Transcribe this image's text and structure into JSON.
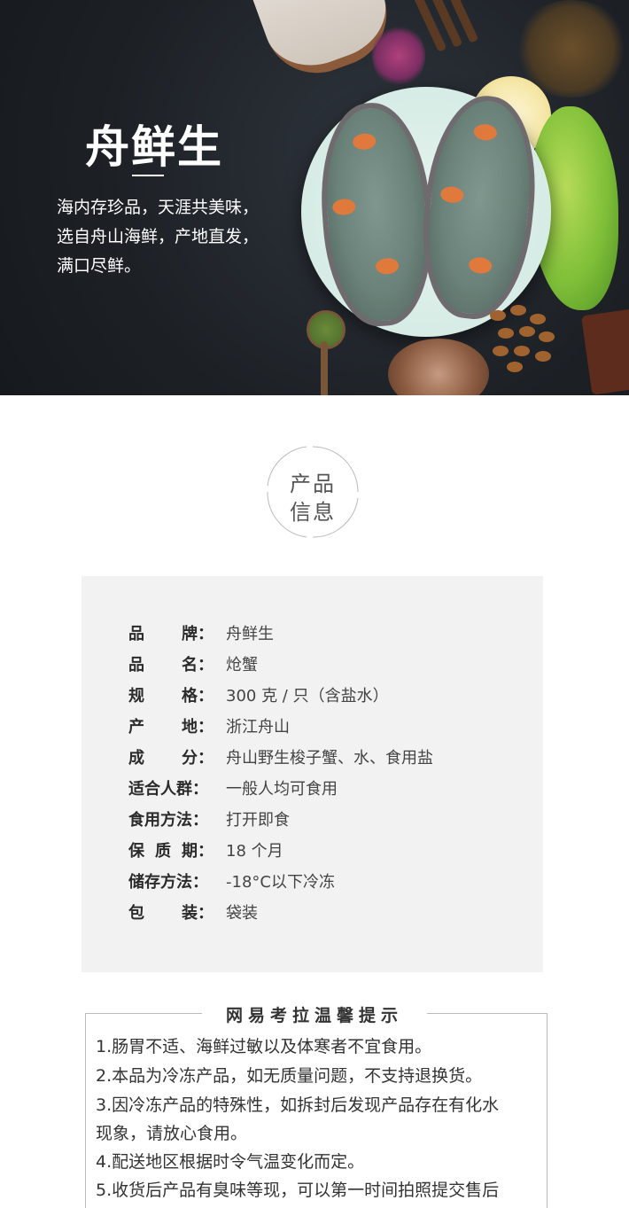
{
  "hero": {
    "brand": "舟鲜生",
    "slogan": [
      "海内存珍品，天涯共美味，",
      "选自舟山海鲜，产地直发，",
      "满口尽鲜。"
    ]
  },
  "section": {
    "title_line1": "产品",
    "title_line2": "信息"
  },
  "specs": [
    {
      "key": [
        "品",
        "牌："
      ],
      "value": "舟鲜生"
    },
    {
      "key": [
        "品",
        "名："
      ],
      "value": "炝蟹"
    },
    {
      "key": [
        "规",
        "格："
      ],
      "value": "300 克 / 只（含盐水）"
    },
    {
      "key": [
        "产",
        "地："
      ],
      "value": "浙江舟山"
    },
    {
      "key": [
        "成",
        "分："
      ],
      "value": "舟山野生梭子蟹、水、食用盐"
    },
    {
      "key": [
        "适合人群："
      ],
      "value": "一般人均可食用"
    },
    {
      "key": [
        "食用方法："
      ],
      "value": "打开即食"
    },
    {
      "key": [
        "保",
        "质",
        "期："
      ],
      "value": "18 个月"
    },
    {
      "key": [
        "储存方法："
      ],
      "value": "-18°C以下冷冻"
    },
    {
      "key": [
        "包",
        "装："
      ],
      "value": "袋装"
    }
  ],
  "tips": {
    "title": "网易考拉温馨提示",
    "items": [
      "1.肠胃不适、海鲜过敏以及体寒者不宜食用。",
      "2.本品为冷冻产品，如无质量问题，不支持退换货。",
      "3.因冷冻产品的特殊性，如拆封后发现产品存在有化水",
      "  现象，请放心食用。",
      "4.配送地区根据时令气温变化而定。",
      "5.收货后产品有臭味等现，可以第一时间拍照提交售后"
    ]
  }
}
